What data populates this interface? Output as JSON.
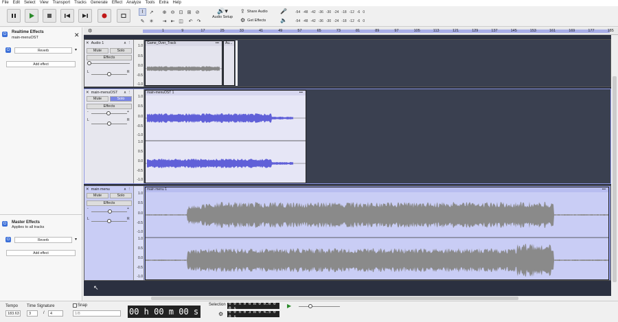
{
  "menu": [
    "File",
    "Edit",
    "Select",
    "View",
    "Transport",
    "Tracks",
    "Generate",
    "Effect",
    "Analyze",
    "Tools",
    "Extra",
    "Help"
  ],
  "toolbar": {
    "audio_setup": "Audio Setup",
    "share_audio": "Share Audio",
    "get_effects": "Get Effects",
    "meter_ticks": [
      "-54",
      "-48",
      "-42",
      "-36",
      "-30",
      "-24",
      "-18",
      "-12",
      "-6",
      "0"
    ],
    "meter_ticks2": [
      "-54",
      "-48",
      "-42",
      "-36",
      "-30",
      "-24",
      "-18",
      "-12",
      "-6",
      "0"
    ]
  },
  "realtime_panel": {
    "title": "Realtime Effects",
    "track": "main-menuOST",
    "effect": "Reverb",
    "add_effect": "Add effect"
  },
  "master_panel": {
    "title": "Master Effects",
    "subtitle": "Applies to all tracks",
    "effect": "Reverb",
    "add_effect": "Add effect"
  },
  "ruler": [
    "1",
    "9",
    "17",
    "25",
    "33",
    "41",
    "49",
    "57",
    "65",
    "73",
    "81",
    "89",
    "97",
    "105",
    "113",
    "121",
    "129",
    "137",
    "145",
    "153",
    "161",
    "169",
    "177",
    "185",
    "193"
  ],
  "tracks": [
    {
      "name": "Audio 1",
      "mute": "Mute",
      "solo": "Solo",
      "effects": "Effects",
      "scale": [
        "1.0",
        "0.5",
        "0.0",
        "-0.5",
        "-1.0"
      ],
      "clips": [
        {
          "name": "Game_Over_Track"
        },
        {
          "name": "Au..."
        }
      ]
    },
    {
      "name": "main-menuOST",
      "mute": "Mute",
      "solo": "Solo",
      "effects": "Effects",
      "scale": [
        "1.0",
        "0.5",
        "0.0",
        "-0.5",
        "-1.0",
        "1.0",
        "0.5",
        "0.0",
        "-0.5",
        "-1.0"
      ],
      "clips": [
        {
          "name": "main-menuOST 1"
        }
      ]
    },
    {
      "name": "main menu",
      "mute": "Mute",
      "solo": "Solo",
      "effects": "Effects",
      "scale": [
        "1.0",
        "0.5",
        "0.0",
        "-0.5",
        "-1.0",
        "1.0",
        "0.5",
        "0.0",
        "-0.5",
        "-1.0"
      ],
      "clips": [
        {
          "name": "main menu 1"
        }
      ]
    }
  ],
  "bottom": {
    "tempo_label": "Tempo",
    "tempo": "183.63",
    "timesig_label": "Time Signature",
    "timesig_num": "3",
    "timesig_den": "4",
    "snap_label": "Snap",
    "snap_value": "1/8",
    "time_display": "00 h 00 m 00 s",
    "selection_label": "Selection",
    "sel_start": "0 0 h 0 0 m 0 0.0 0 0 s",
    "sel_end": "0 0 h 0 3 m 0 4.5 0 0 s"
  },
  "colors": {
    "accent": "#3b6fd8",
    "selected_clip": "#c9cdf5",
    "waveform_purple": "#6060d8",
    "waveform_gray": "#888",
    "track_bg": "#3a4050"
  }
}
